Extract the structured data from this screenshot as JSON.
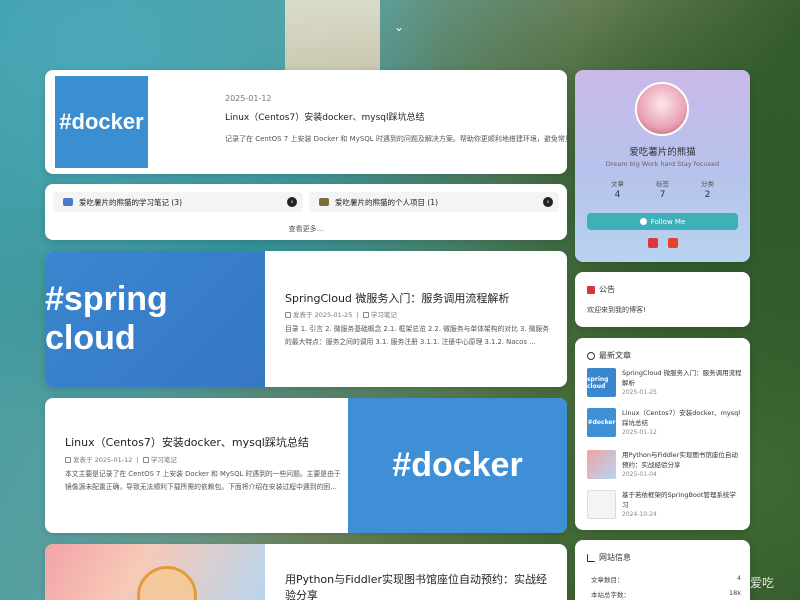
{
  "nav": {
    "chevron": "⌄"
  },
  "featured": {
    "thumb_text": "#docker",
    "date": "2025-01-12",
    "title": "Linux（Centos7）安装docker、mysql踩坑总结",
    "desc": "记录了在 CentOS 7 上安装 Docker 和 MySQL 时遇到的问题及解决方案。帮助你更顺利地搭建环境，避免常见的坑。"
  },
  "categories": {
    "items": [
      {
        "label": "爱吃薯片的熊猫的学习笔记 (3)"
      },
      {
        "label": "爱吃薯片的熊猫的个人项目 (1)"
      }
    ],
    "see_more": "查看更多..."
  },
  "posts": [
    {
      "cover_text": "#spring cloud",
      "title": "SpringCloud 微服务入门：服务调用流程解析",
      "date": "发表于 2025-01-25",
      "category": "学习笔记",
      "desc": "目录 1. 引言 2. 微服务基础概念 2.1. 框架总览 2.2. 微服务与单体架构的对比 3. 微服务的最大特点：服务之间的调用 3.1. 服务注册 3.1.1. 注册中心原理 3.1.2. Nacos …"
    },
    {
      "cover_text": "#docker",
      "title": "Linux（Centos7）安装docker、mysql踩坑总结",
      "date": "发表于 2025-01-12",
      "category": "学习笔记",
      "desc": "本文主要是记录了在 CentOS 7 上安装 Docker 和 MySQL 时遇到的一些问题。主要是由于镜像源未配置正确，导致无法顺利下载所需的依赖包。下面将介绍在安装过程中遇到的困…"
    },
    {
      "title": "用Python与Fiddler实现图书馆座位自动预约：实战经验分享"
    }
  ],
  "profile": {
    "name": "爱吃薯片的熊猫",
    "motto": "Dream big Work hard Stay focused",
    "stats": [
      {
        "label": "文章",
        "value": "4"
      },
      {
        "label": "标签",
        "value": "7"
      },
      {
        "label": "分类",
        "value": "2"
      }
    ],
    "follow_label": "Follow Me"
  },
  "notice": {
    "heading": "公告",
    "text": "欢迎来到我的博客!"
  },
  "recent": {
    "heading": "最新文章",
    "items": [
      {
        "thumb": "spring cloud",
        "title": "SpringCloud 微服务入门：服务调用流程解析",
        "date": "2025-01-25"
      },
      {
        "thumb": "#docker",
        "title": "Linux（Centos7）安装docker、mysql踩坑总结",
        "date": "2025-01-12"
      },
      {
        "thumb": "",
        "title": "用Python与Fiddler实现图书馆座位自动预约：实战经验分享",
        "date": "2025-01-04"
      },
      {
        "thumb": "",
        "title": "基于若依框架的SpringBoot管理系统学习",
        "date": "2024-10-24"
      }
    ]
  },
  "siteinfo": {
    "heading": "网站信息",
    "rows": [
      {
        "label": "文章数目：",
        "value": "4"
      },
      {
        "label": "本站总字数：",
        "value": "18k"
      }
    ]
  },
  "watermark": "CSDN @爱吃"
}
